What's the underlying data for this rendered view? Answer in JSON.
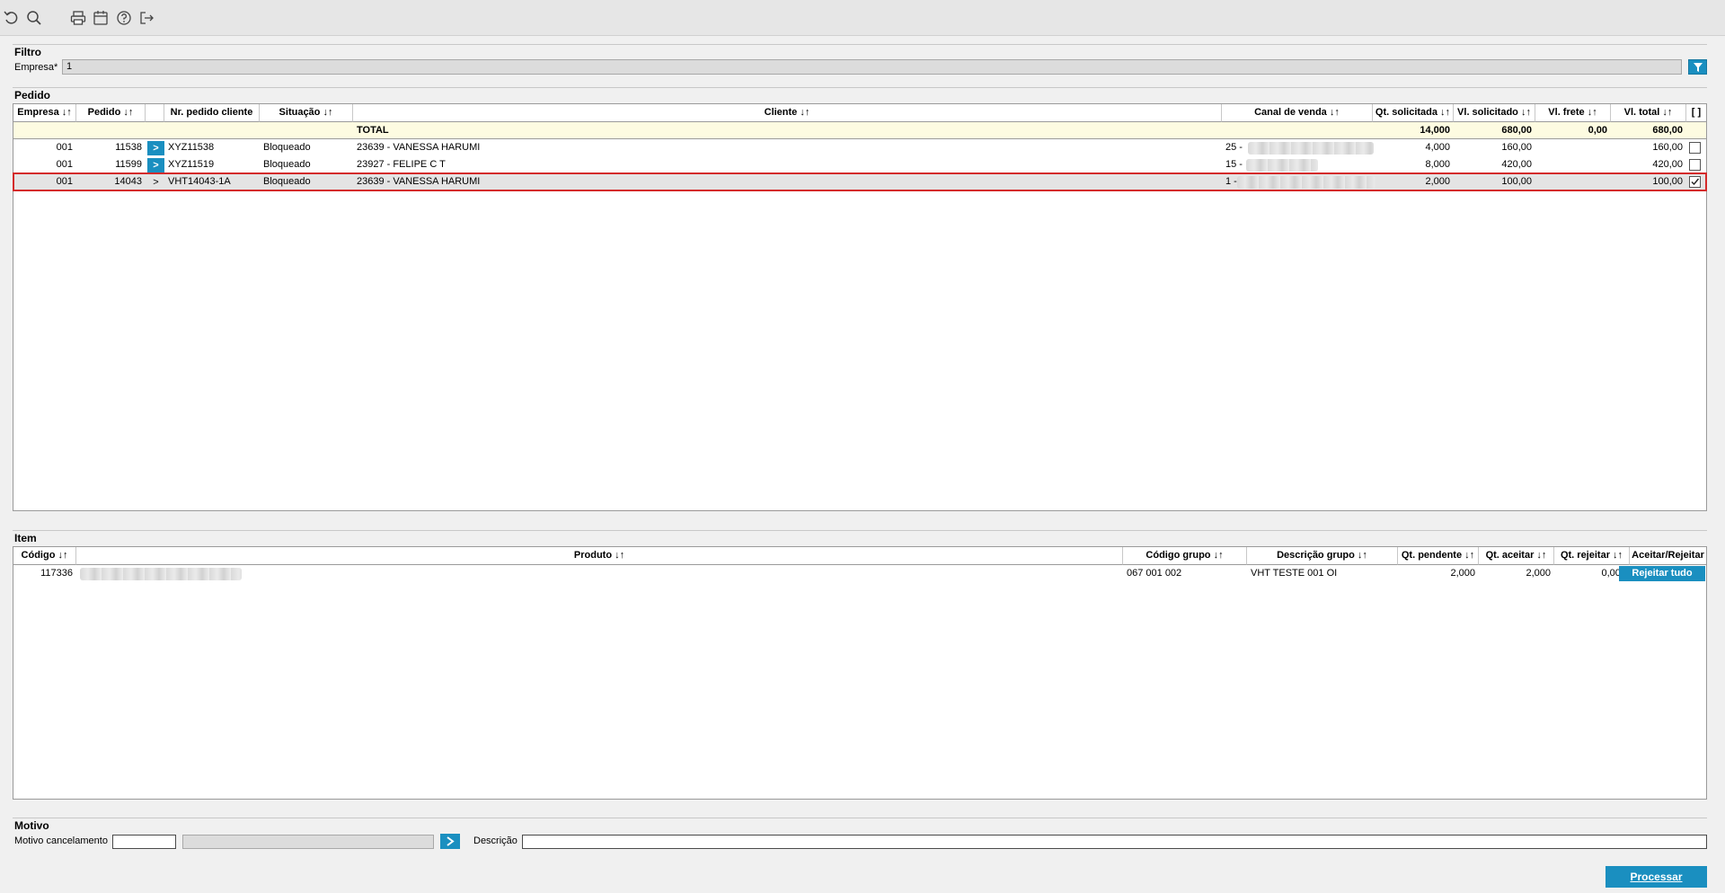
{
  "toolbar": {
    "icons": [
      "refresh-icon",
      "search-icon",
      "print-icon",
      "calendar-icon",
      "help-icon",
      "exit-icon"
    ]
  },
  "filtro": {
    "title": "Filtro",
    "empresa_label": "Empresa*",
    "empresa_value": "1"
  },
  "pedido": {
    "title": "Pedido",
    "headers": {
      "empresa": "Empresa ↓↑",
      "pedido": "Pedido ↓↑",
      "nr_pedido_cliente": "Nr. pedido cliente",
      "situacao": "Situação ↓↑",
      "cliente": "Cliente ↓↑",
      "canal_venda": "Canal de venda ↓↑",
      "qt_solicitada": "Qt. solicitada ↓↑",
      "vl_solicitado": "Vl. solicitado ↓↑",
      "vl_frete": "Vl. frete ↓↑",
      "vl_total": "Vl. total ↓↑",
      "select": "[ ]"
    },
    "total": {
      "label": "TOTAL",
      "qt_solicitada": "14,000",
      "vl_solicitado": "680,00",
      "vl_frete": "0,00",
      "vl_total": "680,00"
    },
    "rows": [
      {
        "empresa": "001",
        "pedido": "11538",
        "go": ">",
        "nr_pedido_cliente": "XYZ11538",
        "situacao": "Bloqueado",
        "cliente": "23639 - VANESSA HARUMI",
        "canal_venda": "25 -",
        "qt_solicitada": "4,000",
        "vl_solicitado": "160,00",
        "vl_frete": "",
        "vl_total": "160,00",
        "checked": false
      },
      {
        "empresa": "001",
        "pedido": "11599",
        "go": ">",
        "nr_pedido_cliente": "XYZ11519",
        "situacao": "Bloqueado",
        "cliente": "23927 - FELIPE C T",
        "canal_venda": "15 -",
        "qt_solicitada": "8,000",
        "vl_solicitado": "420,00",
        "vl_frete": "",
        "vl_total": "420,00",
        "checked": false
      },
      {
        "empresa": "001",
        "pedido": "14043",
        "go": ">",
        "nr_pedido_cliente": "VHT14043-1A",
        "situacao": "Bloqueado",
        "cliente": "23639 - VANESSA HARUMI",
        "canal_venda": "1 -",
        "qt_solicitada": "2,000",
        "vl_solicitado": "100,00",
        "vl_frete": "",
        "vl_total": "100,00",
        "checked": true
      }
    ]
  },
  "item": {
    "title": "Item",
    "headers": {
      "codigo": "Código ↓↑",
      "produto": "Produto ↓↑",
      "codigo_grupo": "Código grupo ↓↑",
      "descricao_grupo": "Descrição grupo ↓↑",
      "qt_pendente": "Qt. pendente ↓↑",
      "qt_aceitar": "Qt. aceitar ↓↑",
      "qt_rejeitar": "Qt. rejeitar ↓↑",
      "aceitar_rejeitar": "Aceitar/Rejeitar"
    },
    "rows": [
      {
        "codigo": "117336",
        "codigo_grupo": "067 001 002",
        "descricao_grupo": "VHT TESTE 001 OI",
        "qt_pendente": "2,000",
        "qt_aceitar": "2,000",
        "qt_rejeitar": "0,000",
        "action": "Rejeitar tudo"
      }
    ]
  },
  "motivo": {
    "title": "Motivo",
    "cancelamento_label": "Motivo cancelamento",
    "descricao_label": "Descrição",
    "go": ">"
  },
  "actions": {
    "processar": "Processar"
  },
  "colors": {
    "accent": "#1a8fc0",
    "total_row": "#fdfbe1",
    "selected_border": "#d42b2b"
  }
}
